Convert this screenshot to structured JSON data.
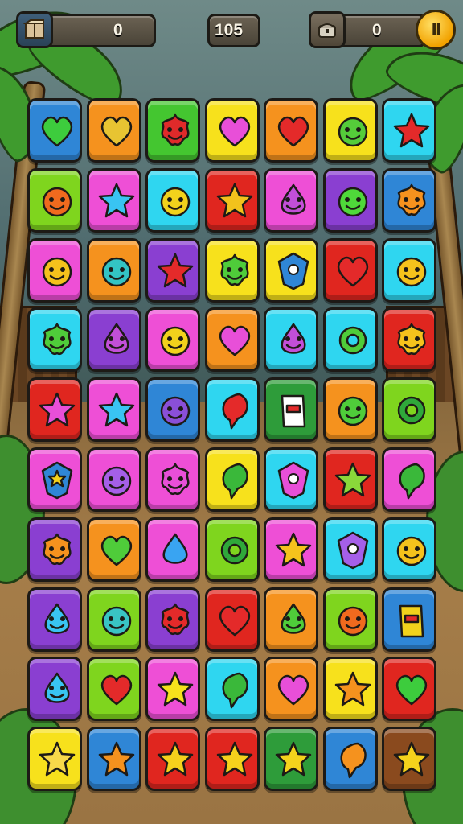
{
  "hud": {
    "left_counter": "0",
    "center_counter": "105",
    "right_counter": "0",
    "pause_label": "II"
  },
  "colors": {
    "blue": "#2f86d6",
    "orange": "#f5921e",
    "green": "#44c630",
    "yellow": "#f7e11c",
    "cyan": "#2fd6f0",
    "pink": "#ee4fd6",
    "red": "#e0261f",
    "purple": "#8a3fd1",
    "lime": "#7fd51e",
    "brown": "#8a4a1e",
    "darkgreen": "#2e9c3a"
  },
  "board": {
    "rows": [
      [
        [
          "blue",
          "heart",
          "#3dcc3d"
        ],
        [
          "orange",
          "heart",
          "#e8c432"
        ],
        [
          "green",
          "star-blob",
          "#e02a2a"
        ],
        [
          "yellow",
          "heart",
          "#e84fd8"
        ],
        [
          "orange",
          "heart",
          "#e42a2a"
        ],
        [
          "yellow",
          "face",
          "#55cc3a"
        ],
        [
          "cyan",
          "star",
          "#e42a2a"
        ]
      ],
      [
        [
          "lime",
          "face",
          "#f06a1e"
        ],
        [
          "pink",
          "star",
          "#39c4f2"
        ],
        [
          "cyan",
          "face",
          "#f2d21c"
        ],
        [
          "red",
          "star",
          "#f2c21c"
        ],
        [
          "pink",
          "drop-face",
          "#c24fd8"
        ],
        [
          "purple",
          "face",
          "#4fd83a"
        ],
        [
          "blue",
          "star-blob",
          "#f5921e"
        ]
      ],
      [
        [
          "pink",
          "face",
          "#f5c21c"
        ],
        [
          "orange",
          "face",
          "#33c4c4"
        ],
        [
          "purple",
          "star",
          "#e42a2a"
        ],
        [
          "yellow",
          "star-blob",
          "#4fcc3a"
        ],
        [
          "yellow",
          "gem",
          "#2f86d6"
        ],
        [
          "red",
          "heart",
          "#e42a2a"
        ],
        [
          "cyan",
          "face",
          "#f5c21c"
        ]
      ],
      [
        [
          "cyan",
          "star-blob",
          "#4fcc3a"
        ],
        [
          "purple",
          "drop-face",
          "#c24fd8"
        ],
        [
          "pink",
          "face",
          "#f2d21c"
        ],
        [
          "orange",
          "heart",
          "#e84fd8"
        ],
        [
          "cyan",
          "drop-face",
          "#c24fd8"
        ],
        [
          "cyan",
          "ring",
          "#4fcc3a"
        ],
        [
          "red",
          "star-blob",
          "#f5c21c"
        ]
      ],
      [
        [
          "red",
          "star",
          "#e84fd8"
        ],
        [
          "pink",
          "star",
          "#39c4f2"
        ],
        [
          "blue",
          "face",
          "#8a4fd8"
        ],
        [
          "cyan",
          "swirl",
          "#e42a2a"
        ],
        [
          "darkgreen",
          "card",
          "#ffffff"
        ],
        [
          "orange",
          "face",
          "#4fcc3a"
        ],
        [
          "lime",
          "ring",
          "#2fa83a"
        ]
      ],
      [
        [
          "pink",
          "gem-star",
          "#2f86d6"
        ],
        [
          "pink",
          "face",
          "#a55fe8"
        ],
        [
          "pink",
          "star-blob",
          "#e84fd8"
        ],
        [
          "yellow",
          "swirl",
          "#3ab83a"
        ],
        [
          "cyan",
          "gem",
          "#e84fd8"
        ],
        [
          "red",
          "star",
          "#8ad83a"
        ],
        [
          "pink",
          "swirl",
          "#3ab83a"
        ]
      ],
      [
        [
          "purple",
          "star-blob",
          "#f5921e"
        ],
        [
          "orange",
          "heart",
          "#4fcc3a"
        ],
        [
          "pink",
          "drop",
          "#39a4f2"
        ],
        [
          "lime",
          "ring",
          "#2fa83a"
        ],
        [
          "pink",
          "star",
          "#f5c21c"
        ],
        [
          "cyan",
          "gem",
          "#a55fe8"
        ],
        [
          "cyan",
          "face",
          "#f5c21c"
        ]
      ],
      [
        [
          "purple",
          "drop-face",
          "#39c4f2"
        ],
        [
          "lime",
          "face",
          "#39c4c4"
        ],
        [
          "purple",
          "star-blob",
          "#e42a2a"
        ],
        [
          "red",
          "heart",
          "#e42a2a"
        ],
        [
          "orange",
          "drop-face",
          "#4fcc3a"
        ],
        [
          "lime",
          "face",
          "#f06a1e"
        ],
        [
          "blue",
          "card",
          "#f2d21c"
        ]
      ],
      [
        [
          "purple",
          "drop-face",
          "#39c4f2"
        ],
        [
          "lime",
          "heart",
          "#e42a2a"
        ],
        [
          "pink",
          "star",
          "#f5e21c"
        ],
        [
          "cyan",
          "swirl",
          "#3ab83a"
        ],
        [
          "orange",
          "heart",
          "#e84fd8"
        ],
        [
          "yellow",
          "star",
          "#f5921e"
        ],
        [
          "red",
          "heart",
          "#3dcc3d"
        ]
      ],
      [
        [
          "yellow",
          "star",
          "#f7d84a"
        ],
        [
          "blue",
          "star",
          "#f5921e"
        ],
        [
          "red",
          "star",
          "#f5d21c"
        ],
        [
          "red",
          "star",
          "#f5d21c"
        ],
        [
          "darkgreen",
          "star",
          "#f5d21c"
        ],
        [
          "blue",
          "swirl",
          "#f5921e"
        ],
        [
          "brown",
          "star",
          "#f5d21c"
        ]
      ]
    ]
  }
}
